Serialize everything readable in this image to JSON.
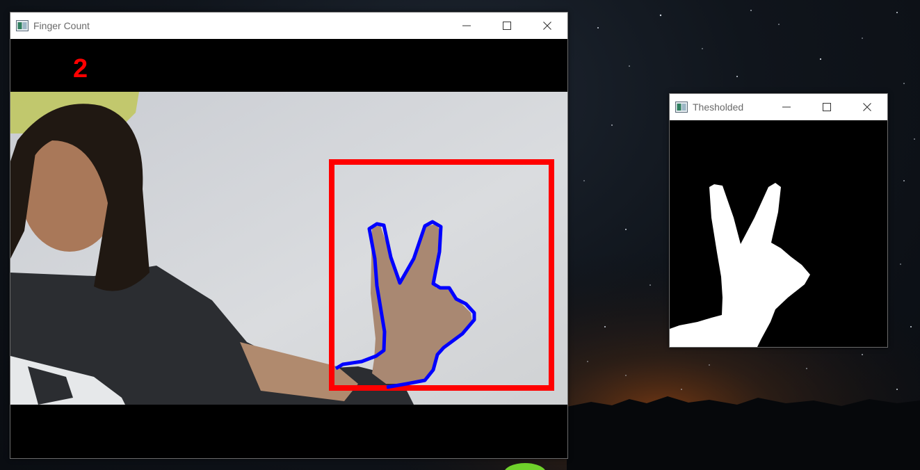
{
  "windows": {
    "finger_count": {
      "title": "Finger Count",
      "count_text": "2",
      "count_color": "#ff0000",
      "roi_box_color": "#ff0000",
      "contour_color": "#0000ff"
    },
    "thresholded": {
      "title": "Thesholded",
      "mask_color": "#ffffff",
      "background_color": "#000000"
    }
  },
  "window_controls": {
    "minimize_icon": "minimize-icon",
    "maximize_icon": "maximize-icon",
    "close_icon": "close-icon"
  }
}
